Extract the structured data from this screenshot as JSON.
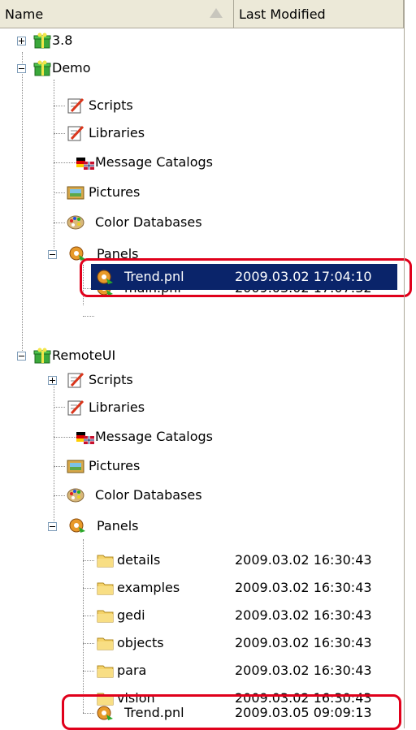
{
  "header": {
    "name_col": "Name",
    "modified_col": "Last Modified"
  },
  "tree": {
    "n38": {
      "label": "3.8"
    },
    "demo": {
      "label": "Demo",
      "scripts": "Scripts",
      "libraries": "Libraries",
      "message_catalogs": "Message Catalogs",
      "pictures": "Pictures",
      "color_databases": "Color Databases",
      "panels": "Panels",
      "main_pnl": {
        "label": "main.pnl",
        "date": "2009.03.02 17:07:32"
      },
      "trend_pnl": {
        "label": "Trend.pnl",
        "date": "2009.03.02 17:04:10"
      }
    },
    "remote": {
      "label": "RemoteUI",
      "scripts": "Scripts",
      "libraries": "Libraries",
      "message_catalogs": "Message Catalogs",
      "pictures": "Pictures",
      "color_databases": "Color Databases",
      "panels": "Panels",
      "folders": [
        {
          "label": "details",
          "date": "2009.03.02 16:30:43"
        },
        {
          "label": "examples",
          "date": "2009.03.02 16:30:43"
        },
        {
          "label": "gedi",
          "date": "2009.03.02 16:30:43"
        },
        {
          "label": "objects",
          "date": "2009.03.02 16:30:43"
        },
        {
          "label": "para",
          "date": "2009.03.02 16:30:43"
        },
        {
          "label": "vision",
          "date": "2009.03.02 16:30:43"
        }
      ],
      "trend_pnl": {
        "label": "Trend.pnl",
        "date": "2009.03.05 09:09:13"
      }
    }
  },
  "colors": {
    "selection": "#0a246a",
    "highlight": "#e0001b",
    "header_bg": "#ece9d8"
  }
}
